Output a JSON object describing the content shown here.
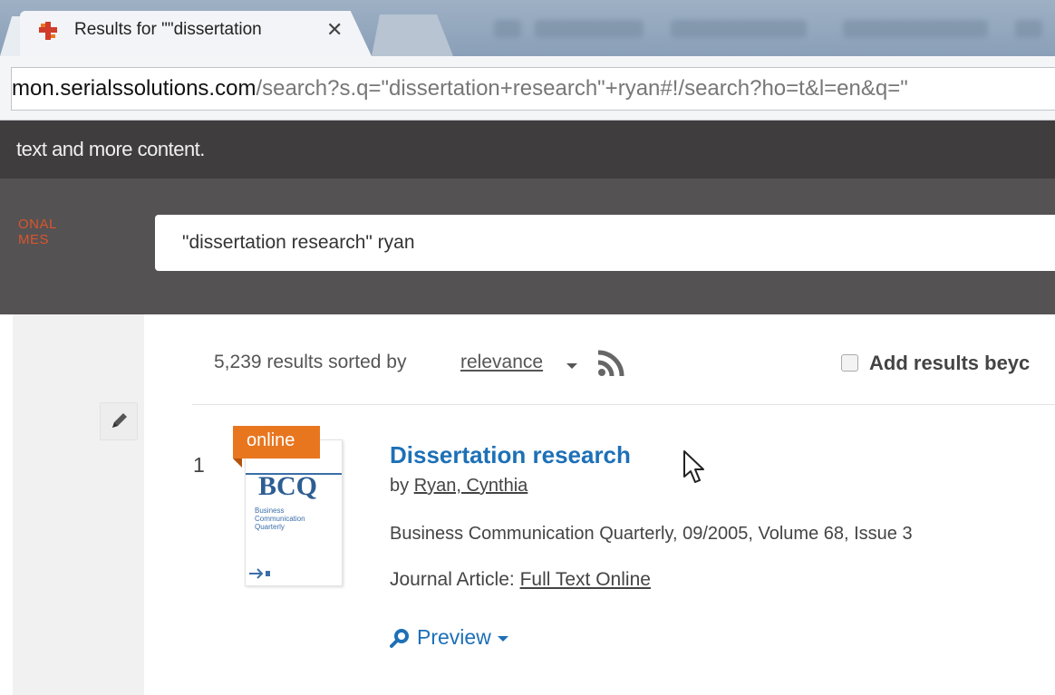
{
  "browser": {
    "tab_title": "Results for \"\"dissertation",
    "tab_close": "✕",
    "url_host": "mon.serialssolutions.com",
    "url_path": "/search?s.q=\"dissertation+research\"+ryan#!/search?ho=t&l=en&q=\""
  },
  "site": {
    "notice_text": "text and more content.",
    "logo_lines": [
      "ONAL",
      "MES"
    ],
    "search_query": "\"dissertation research\" ryan"
  },
  "results": {
    "summary": "5,239 results sorted by",
    "sort_value": "relevance",
    "add_results_label": "Add results beyc",
    "items": [
      {
        "number": "1",
        "badge": "online",
        "title": "Dissertation research",
        "by_prefix": "by",
        "author": "Ryan, Cynthia",
        "publication": "Business Communication Quarterly, 09/2005, Volume 68, Issue 3",
        "type_label": "Journal Article:",
        "fulltext_label": "Full Text Online",
        "preview_label": "Preview",
        "cover_title": "BCQ",
        "cover_lines": [
          "Business",
          "Communication",
          "Quarterly"
        ]
      }
    ]
  },
  "colors": {
    "link_blue": "#1d70b7",
    "badge_orange": "#e8761f",
    "header_dark": "#3f3d3e",
    "search_band": "#555253",
    "logo_orange": "#d9552e"
  },
  "icons": [
    "favicon-icon",
    "close-icon",
    "pencil-icon",
    "rss-icon",
    "magnifier-icon",
    "chevron-down-icon",
    "mouse-cursor-icon"
  ]
}
